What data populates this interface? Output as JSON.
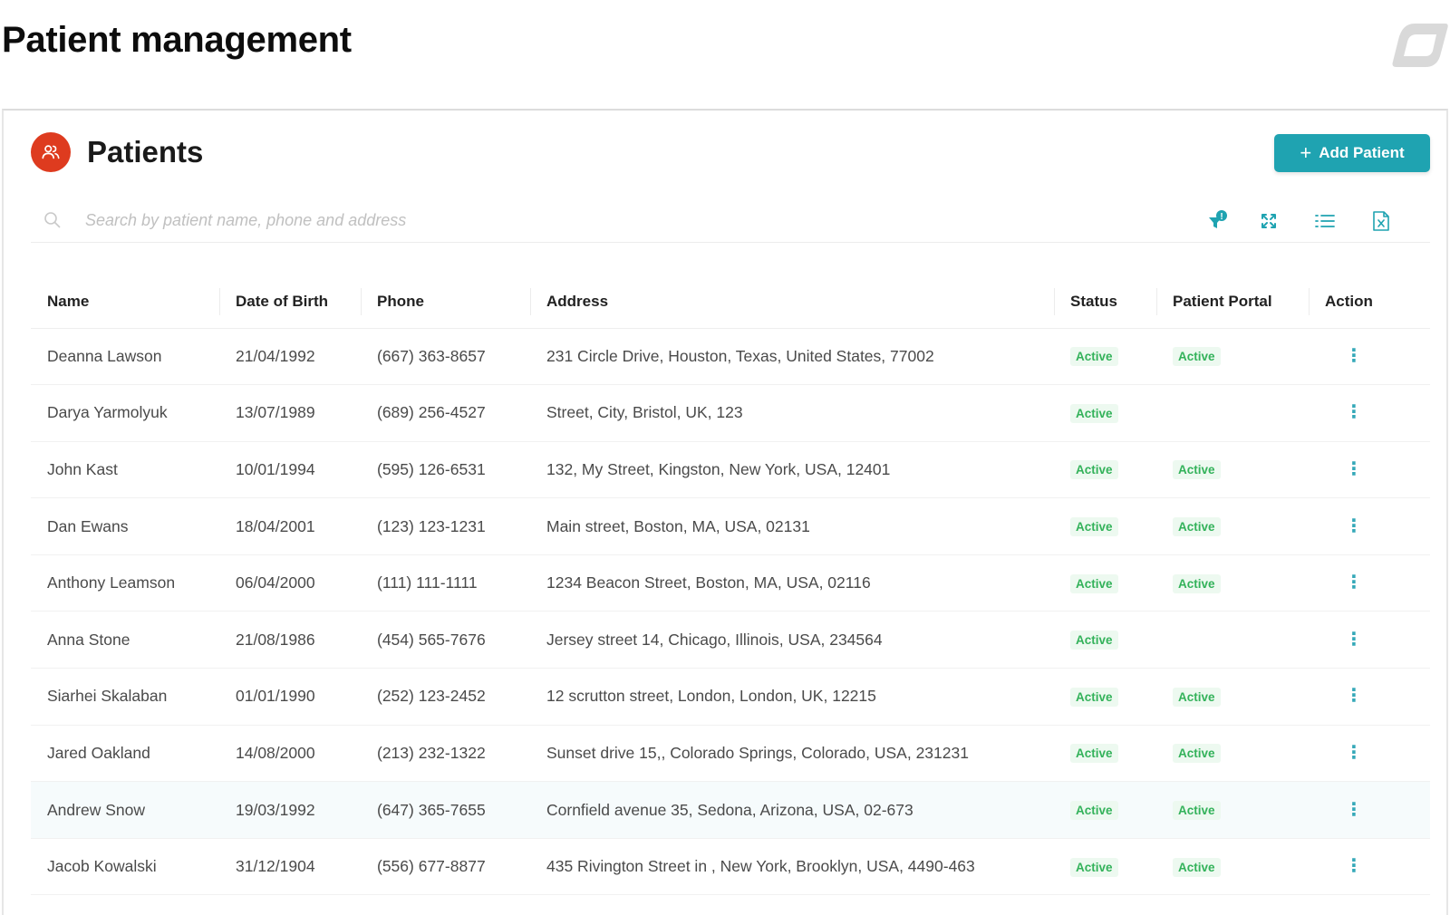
{
  "page": {
    "title": "Patient management"
  },
  "panel": {
    "title": "Patients",
    "icon": "users-icon",
    "add_button": "Add Patient"
  },
  "search": {
    "placeholder": "Search by patient name, phone and address"
  },
  "toolbar": {
    "icons": [
      "filter-icon",
      "expand-icon",
      "list-icon",
      "export-excel-icon"
    ],
    "filter_badge": "!"
  },
  "table": {
    "columns": [
      "Name",
      "Date of Birth",
      "Phone",
      "Address",
      "Status",
      "Patient Portal",
      "Action"
    ],
    "rows": [
      {
        "name": "Deanna Lawson",
        "dob": "21/04/1992",
        "phone": "(667) 363-8657",
        "address": "231 Circle Drive, Houston, Texas, United States, 77002",
        "status": "Active",
        "portal": "Active"
      },
      {
        "name": "Darya Yarmolyuk",
        "dob": "13/07/1989",
        "phone": "(689) 256-4527",
        "address": "Street, City, Bristol, UK, 123",
        "status": "Active",
        "portal": ""
      },
      {
        "name": "John Kast",
        "dob": "10/01/1994",
        "phone": "(595) 126-6531",
        "address": "132, My Street, Kingston, New York, USA, 12401",
        "status": "Active",
        "portal": "Active"
      },
      {
        "name": "Dan Ewans",
        "dob": "18/04/2001",
        "phone": "(123) 123-1231",
        "address": "Main street, Boston, MA, USA, 02131",
        "status": "Active",
        "portal": "Active"
      },
      {
        "name": "Anthony Leamson",
        "dob": "06/04/2000",
        "phone": "(111) 111-1111",
        "address": "1234 Beacon Street, Boston, MA, USA, 02116",
        "status": "Active",
        "portal": "Active"
      },
      {
        "name": "Anna Stone",
        "dob": "21/08/1986",
        "phone": "(454) 565-7676",
        "address": "Jersey street 14, Chicago, Illinois, USA, 234564",
        "status": "Active",
        "portal": ""
      },
      {
        "name": "Siarhei Skalaban",
        "dob": "01/01/1990",
        "phone": "(252) 123-2452",
        "address": "12 scrutton street, London, London, UK, 12215",
        "status": "Active",
        "portal": "Active"
      },
      {
        "name": "Jared Oakland",
        "dob": "14/08/2000",
        "phone": "(213) 232-1322",
        "address": "Sunset drive 15,, Colorado Springs, Colorado, USA, 231231",
        "status": "Active",
        "portal": "Active"
      },
      {
        "name": "Andrew Snow",
        "dob": "19/03/1992",
        "phone": "(647) 365-7655",
        "address": "Cornfield avenue 35, Sedona, Arizona, USA, 02-673",
        "status": "Active",
        "portal": "Active",
        "highlighted": true
      },
      {
        "name": "Jacob Kowalski",
        "dob": "31/12/1904",
        "phone": "(556) 677-8877",
        "address": "435 Rivington Street in , New York, Brooklyn, USA, 4490-463",
        "status": "Active",
        "portal": "Active"
      }
    ]
  },
  "colors": {
    "accent": "#1fa3b1",
    "icon_bg": "#de3b1f",
    "link": "#1f9fb0",
    "status_text": "#33b25a",
    "status_bg": "#edf9f0"
  }
}
